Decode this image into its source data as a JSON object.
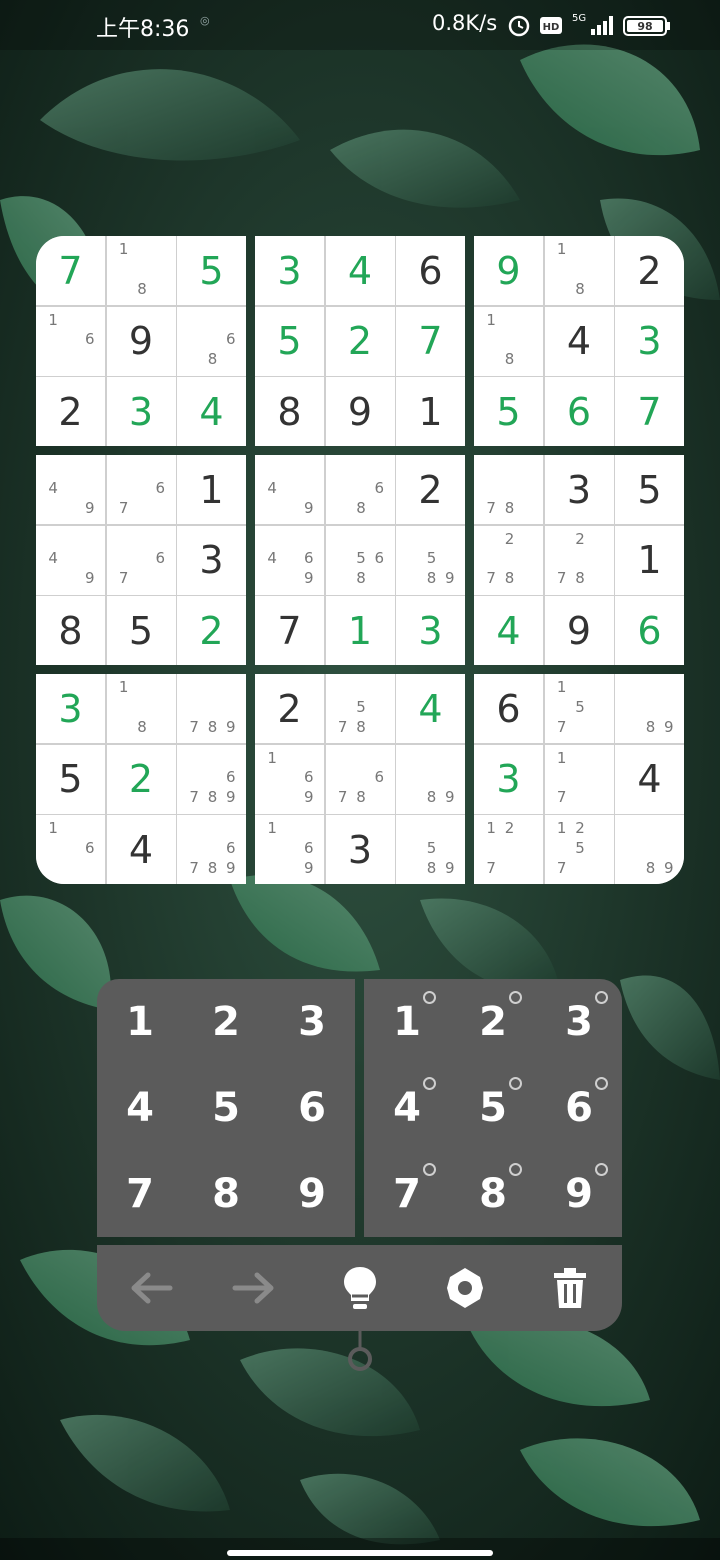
{
  "status": {
    "time": "上午8:36",
    "net_speed": "0.8K/s",
    "network": "5G",
    "hd_label": "HD",
    "battery": "98",
    "icons": [
      "alarm-icon",
      "hd-icon",
      "signal-icon",
      "battery-icon"
    ]
  },
  "colors": {
    "given": "#333333",
    "filled": "#22a657",
    "note": "#777777",
    "pad": "#5b5b5b"
  },
  "board": {
    "rows": [
      [
        {
          "v": "7",
          "t": "filled"
        },
        {
          "n": [
            1,
            8
          ]
        },
        {
          "v": "5",
          "t": "filled"
        },
        {
          "v": "3",
          "t": "filled"
        },
        {
          "v": "4",
          "t": "filled"
        },
        {
          "v": "6",
          "t": "given"
        },
        {
          "v": "9",
          "t": "filled"
        },
        {
          "n": [
            1,
            8
          ]
        },
        {
          "v": "2",
          "t": "given"
        }
      ],
      [
        {
          "n": [
            1,
            6
          ]
        },
        {
          "v": "9",
          "t": "given"
        },
        {
          "n": [
            6,
            8
          ]
        },
        {
          "v": "5",
          "t": "filled"
        },
        {
          "v": "2",
          "t": "filled"
        },
        {
          "v": "7",
          "t": "filled"
        },
        {
          "n": [
            1,
            8
          ]
        },
        {
          "v": "4",
          "t": "given"
        },
        {
          "v": "3",
          "t": "filled"
        }
      ],
      [
        {
          "v": "2",
          "t": "given"
        },
        {
          "v": "3",
          "t": "filled"
        },
        {
          "v": "4",
          "t": "filled"
        },
        {
          "v": "8",
          "t": "given"
        },
        {
          "v": "9",
          "t": "given"
        },
        {
          "v": "1",
          "t": "given"
        },
        {
          "v": "5",
          "t": "filled"
        },
        {
          "v": "6",
          "t": "filled"
        },
        {
          "v": "7",
          "t": "filled"
        }
      ],
      [
        {
          "n": [
            4,
            9
          ]
        },
        {
          "n": [
            6,
            7
          ]
        },
        {
          "v": "1",
          "t": "given"
        },
        {
          "n": [
            4,
            9
          ]
        },
        {
          "n": [
            6,
            8
          ]
        },
        {
          "v": "2",
          "t": "given"
        },
        {
          "n": [
            7,
            8
          ]
        },
        {
          "v": "3",
          "t": "given"
        },
        {
          "v": "5",
          "t": "given"
        }
      ],
      [
        {
          "n": [
            4,
            9
          ]
        },
        {
          "n": [
            6,
            7
          ]
        },
        {
          "v": "3",
          "t": "given"
        },
        {
          "n": [
            4,
            6,
            9
          ]
        },
        {
          "n": [
            5,
            6,
            8
          ]
        },
        {
          "n": [
            5,
            8,
            9
          ]
        },
        {
          "n": [
            2,
            7,
            8
          ]
        },
        {
          "n": [
            2,
            7,
            8
          ]
        },
        {
          "v": "1",
          "t": "given"
        }
      ],
      [
        {
          "v": "8",
          "t": "given"
        },
        {
          "v": "5",
          "t": "given"
        },
        {
          "v": "2",
          "t": "filled"
        },
        {
          "v": "7",
          "t": "given"
        },
        {
          "v": "1",
          "t": "filled"
        },
        {
          "v": "3",
          "t": "filled"
        },
        {
          "v": "4",
          "t": "filled"
        },
        {
          "v": "9",
          "t": "given"
        },
        {
          "v": "6",
          "t": "filled"
        }
      ],
      [
        {
          "v": "3",
          "t": "filled"
        },
        {
          "n": [
            1,
            8
          ]
        },
        {
          "n": [
            7,
            8,
            9
          ]
        },
        {
          "v": "2",
          "t": "given"
        },
        {
          "n": [
            5,
            7,
            8
          ]
        },
        {
          "v": "4",
          "t": "filled"
        },
        {
          "v": "6",
          "t": "given"
        },
        {
          "n": [
            1,
            5,
            7
          ]
        },
        {
          "n": [
            8,
            9
          ]
        }
      ],
      [
        {
          "v": "5",
          "t": "given"
        },
        {
          "v": "2",
          "t": "filled"
        },
        {
          "n": [
            6,
            7,
            8,
            9
          ]
        },
        {
          "n": [
            1,
            6,
            9
          ]
        },
        {
          "n": [
            6,
            7,
            8
          ]
        },
        {
          "n": [
            8,
            9
          ]
        },
        {
          "v": "3",
          "t": "filled"
        },
        {
          "n": [
            1,
            7
          ]
        },
        {
          "v": "4",
          "t": "given"
        }
      ],
      [
        {
          "n": [
            1,
            6
          ]
        },
        {
          "v": "4",
          "t": "given"
        },
        {
          "n": [
            6,
            7,
            8,
            9
          ]
        },
        {
          "n": [
            1,
            6,
            9
          ]
        },
        {
          "v": "3",
          "t": "given"
        },
        {
          "n": [
            5,
            8,
            9
          ]
        },
        {
          "n": [
            1,
            2,
            7
          ]
        },
        {
          "n": [
            1,
            2,
            5,
            7
          ]
        },
        {
          "n": [
            8,
            9
          ]
        }
      ]
    ]
  },
  "pad_left": {
    "keys": [
      "1",
      "2",
      "3",
      "4",
      "5",
      "6",
      "7",
      "8",
      "9"
    ]
  },
  "pad_right": {
    "keys": [
      "1",
      "2",
      "3",
      "4",
      "5",
      "6",
      "7",
      "8",
      "9"
    ]
  },
  "toolbar": {
    "icons": [
      "undo-arrow-icon",
      "redo-arrow-icon",
      "hint-bulb-icon",
      "settings-gear-icon",
      "delete-trash-icon"
    ]
  }
}
